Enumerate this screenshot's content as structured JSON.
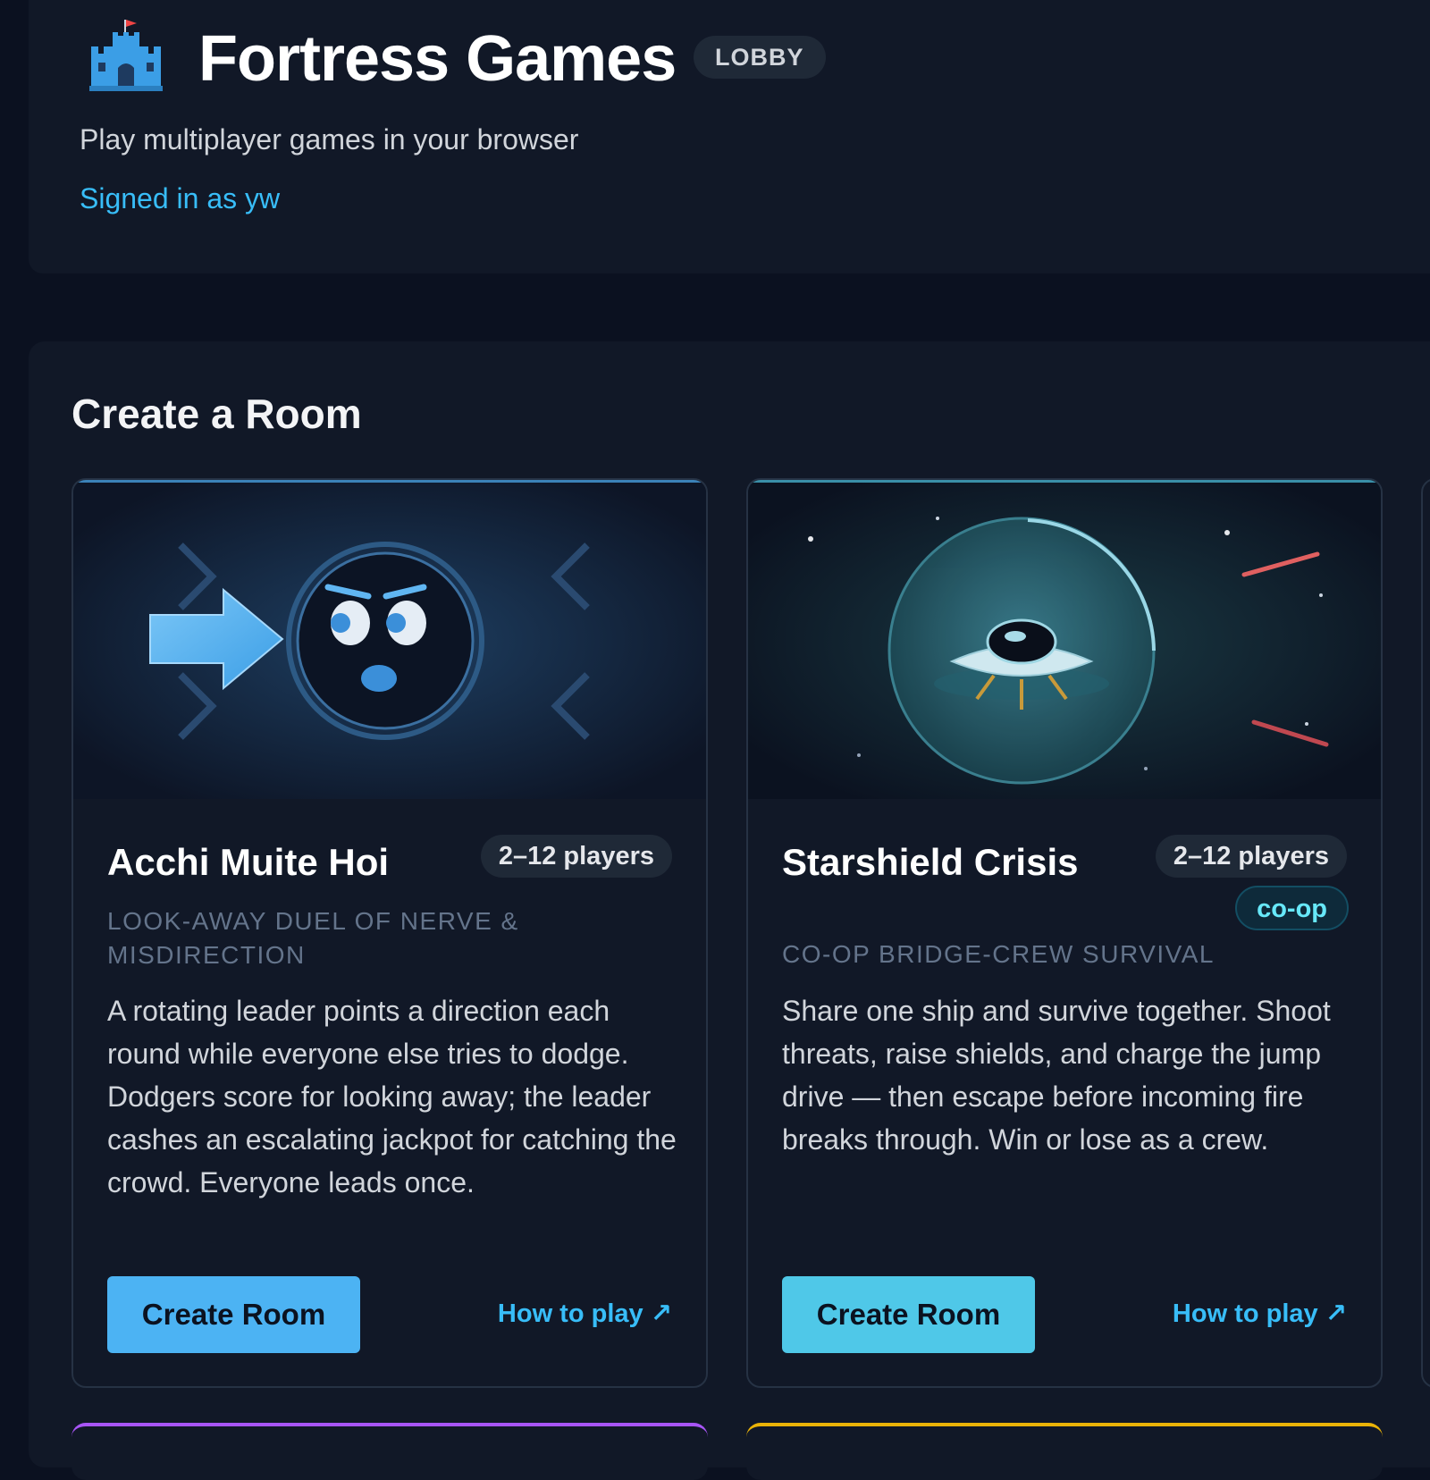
{
  "header": {
    "title": "Fortress Games",
    "badge": "LOBBY",
    "tagline": "Play multiplayer games in your browser",
    "signed_in": "Signed in as yw",
    "logo_icon": "castle-icon"
  },
  "create_section": {
    "heading": "Create a Room"
  },
  "games": [
    {
      "title": "Acchi Muite Hoi",
      "players": "2–12 players",
      "subtitle": "LOOK-AWAY DUEL OF NERVE & MISDIRECTION",
      "description": "A rotating leader points a direction each round while everyone else tries to dodge. Dodgers score for looking away; the leader cashes an escalating jackpot for catching the crowd. Everyone leads once.",
      "create_label": "Create Room",
      "howto_label": "How to play ↗",
      "button_color": "#4cb3f3",
      "hero_icon": "angry-face-arrow-icon"
    },
    {
      "title": "Starshield Crisis",
      "players": "2–12 players",
      "tag": "co-op",
      "subtitle": "CO-OP BRIDGE-CREW SURVIVAL",
      "description": "Share one ship and survive together. Shoot threats, raise shields, and charge the jump drive — then escape before incoming fire breaks through. Win or lose as a crew.",
      "create_label": "Create Room",
      "howto_label": "How to play ↗",
      "button_color": "#4fc8e8",
      "hero_icon": "shielded-ufo-icon"
    }
  ],
  "colors": {
    "background": "#0b1120",
    "panel": "#111827",
    "accent": "#38bdf8",
    "bottom_card_accent_1": "#a855f7",
    "bottom_card_accent_2": "#eab308"
  }
}
